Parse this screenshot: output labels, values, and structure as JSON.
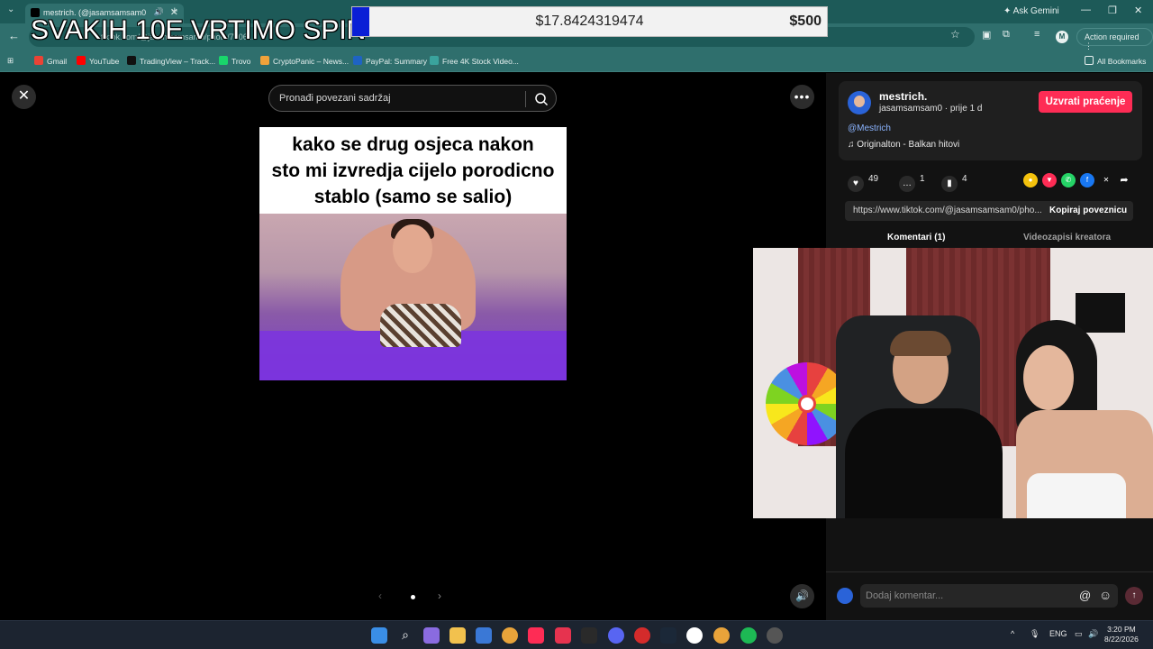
{
  "browser": {
    "tab_title": "mestrich. (@jasamsamsam0",
    "omnibox_url": "tiktok.com/@jasamsamsam0/photo/7406...",
    "ask_gemini": "Ask Gemini",
    "action_required": "Action required",
    "profile_initial": "M",
    "bookmarks": [
      "Gmail",
      "YouTube",
      "TradingView – Track...",
      "Trovo",
      "CryptoPanic – News...",
      "PayPal: Summary",
      "Free 4K Stock Video..."
    ],
    "all_bookmarks": "All Bookmarks"
  },
  "stream_overlay": {
    "title": "SVAKIH 10E VRTIMO SPIN",
    "goal_current": "$17.8424319474",
    "goal_target": "$500",
    "goal_progress_fraction": 0.0357
  },
  "viewer": {
    "search_placeholder": "Pronađi povezani sadržaj",
    "caption_lines": [
      "kako se drug osjeca nakon",
      "sto mi izvredja cijelo porodicno",
      "stablo (samo se salio)"
    ]
  },
  "creator": {
    "display_name": "mestrich.",
    "sub": "jasamsamsam0 · prije 1 d",
    "follow_label": "Uzvrati praćenje",
    "mention": "@Mestrich",
    "sound": "Originalton - Balkan hitovi"
  },
  "stats": {
    "likes": "49",
    "comments": "1",
    "saves": "4"
  },
  "link": {
    "url": "https://www.tiktok.com/@jasamsamsam0/pho...",
    "copy_label": "Kopiraj poveznicu"
  },
  "tabs": {
    "comments": "Komentari (1)",
    "creator_videos": "Videozapisi kreatora"
  },
  "comment_box": {
    "placeholder": "Dodaj komentar..."
  },
  "taskbar": {
    "lang": "ENG",
    "time": "3:20 PM",
    "date": "8/22/2026"
  },
  "colors": {
    "accent": "#fe2c55",
    "chrome": "#2f6f6d",
    "goal_fill": "#0a1fd6"
  }
}
